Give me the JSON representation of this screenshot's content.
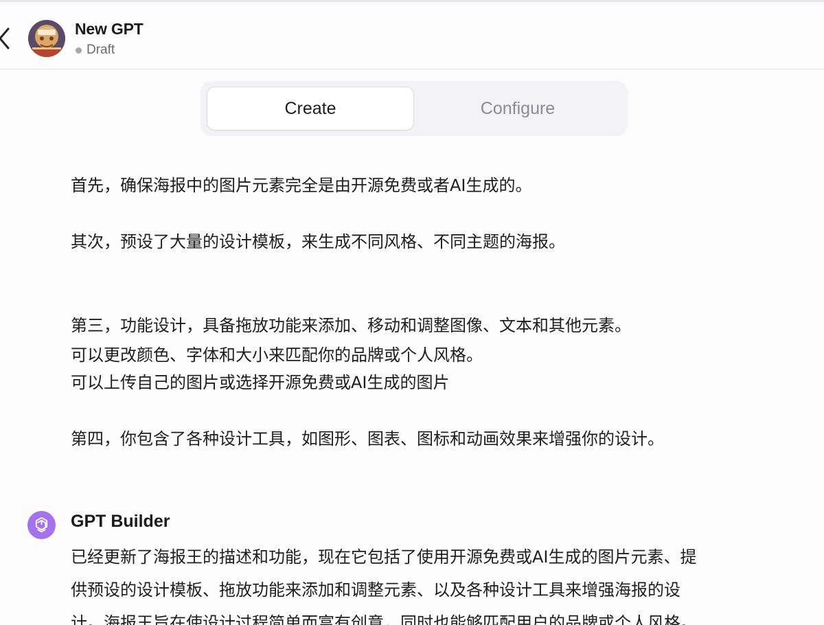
{
  "header": {
    "back_icon": "chevron-left-icon",
    "avatar_icon": "gpt-avatar-image",
    "title": "New GPT",
    "status": "Draft"
  },
  "tabs": [
    {
      "label": "Create",
      "active": true
    },
    {
      "label": "Configure",
      "active": false
    }
  ],
  "user_message": {
    "lines": [
      "首先，确保海报中的图片元素完全是由开源免费或者AI生成的。",
      "其次，预设了大量的设计模板，来生成不同风格、不同主题的海报。",
      "第三，功能设计，具备拖放功能来添加、移动和调整图像、文本和其他元素。",
      "可以更改颜色、字体和大小来匹配你的品牌或个人风格。",
      "可以上传自己的图片或选择开源免费或AI生成的图片",
      "第四，你包含了各种设计工具，如图形、图表、图标和动画效果来增强你的设计。"
    ]
  },
  "builder": {
    "icon": "openai-logo-icon",
    "icon_color": "#a571ee",
    "name": "GPT Builder",
    "lines": [
      "已经更新了海报王的描述和功能，现在它包括了使用开源免费或AI生成的图片元素、提",
      "供预设的设计模板、拖放功能来添加和调整元素、以及各种设计工具来增强海报的设",
      "计。海报王旨在使设计过程简单而富有创意，同时也能够匹配用户的品牌或个人风格。"
    ]
  }
}
